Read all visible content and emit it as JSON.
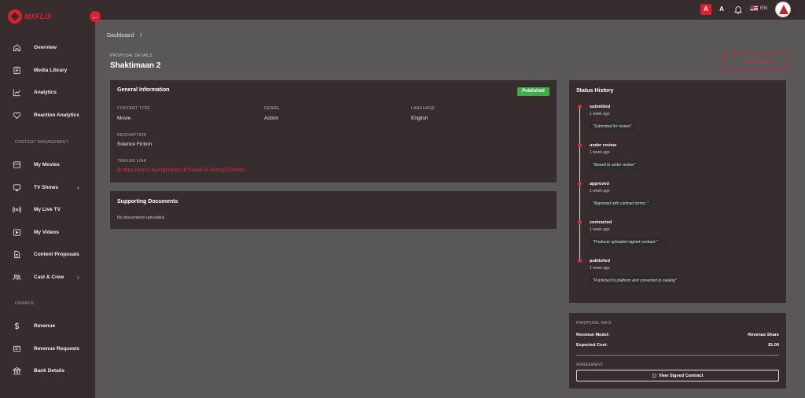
{
  "brand": {
    "name": "MXFLIX"
  },
  "sidebar": {
    "items": [
      {
        "label": "Overview",
        "icon": "home-icon"
      },
      {
        "label": "Media Library",
        "icon": "library-icon"
      },
      {
        "label": "Analytics",
        "icon": "chart-icon"
      },
      {
        "label": "Reaction Analytics",
        "icon": "heart-icon"
      },
      {
        "label": "My Movies",
        "icon": "film-icon"
      },
      {
        "label": "TV Shows",
        "icon": "tv-icon"
      },
      {
        "label": "My Live TV",
        "icon": "broadcast-icon"
      },
      {
        "label": "My Videos",
        "icon": "video-icon"
      },
      {
        "label": "Content Proposals",
        "icon": "document-icon"
      },
      {
        "label": "Cast & Crew",
        "icon": "users-icon"
      },
      {
        "label": "Revenue",
        "icon": "dollar-icon"
      },
      {
        "label": "Revenue Requests",
        "icon": "receipt-icon"
      },
      {
        "label": "Bank Details",
        "icon": "bank-icon"
      }
    ],
    "sections": {
      "content": "CONTENT MANAGEMENT",
      "finance": "FINANCE"
    }
  },
  "header": {
    "font_large": "A",
    "font_small": "A",
    "language": "EN"
  },
  "breadcrumb": {
    "root": "Dashboard",
    "separator": "/"
  },
  "page": {
    "overline": "PROPOSAL DETAILS",
    "title": "Shaktimaan 2",
    "back_label": "← Back to List"
  },
  "general": {
    "title": "General Information",
    "status": "Published",
    "content_type_label": "CONTENT TYPE",
    "content_type": "Movie",
    "genre_label": "GENRE",
    "genre": "Action",
    "language_label": "LANGUAGE",
    "language": "English",
    "description_label": "DESCRIPTION",
    "description": "Science Fiction",
    "trailer_label": "TRAILER LINK",
    "trailer": "⧉ https://youtu.be/OgI23o8z1B?si=bEcE15m0pXZwW9U"
  },
  "documents": {
    "title": "Supporting Documents",
    "empty": "No documents uploaded."
  },
  "status_history": {
    "title": "Status History",
    "entries": [
      {
        "status": "submitted",
        "time": "1 week ago",
        "note": "\"Submitted for review\""
      },
      {
        "status": "under review",
        "time": "1 week ago",
        "note": "\"Moved to under review\""
      },
      {
        "status": "approved",
        "time": "1 week ago",
        "note": "\"Approved with contract terms: \""
      },
      {
        "status": "contracted",
        "time": "1 week ago",
        "note": "\"Producer uploaded signed contract.\""
      },
      {
        "status": "published",
        "time": "1 week ago",
        "note": "\"Published to platform and converted to catalog\""
      }
    ]
  },
  "proposal_info": {
    "title": "PROPOSAL INFO",
    "revenue_model_label": "Revenue Model:",
    "revenue_model": "Revenue Share",
    "expected_cost_label": "Expected Cost:",
    "expected_cost": "$1.00",
    "agreement_label": "AGREEMENT",
    "view_contract_label": "View Signed Contract"
  },
  "colors": {
    "accent": "#e11d2e",
    "panel": "#382d2e",
    "background": "#5a5758",
    "success": "#3fae49"
  }
}
